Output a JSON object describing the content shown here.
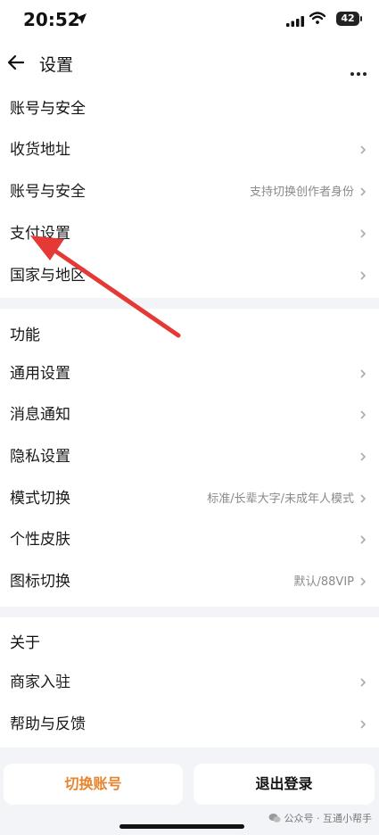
{
  "status_bar": {
    "time": "20:52",
    "battery": "42"
  },
  "header": {
    "title": "设置"
  },
  "sections": [
    {
      "title": "账号与安全",
      "items": [
        {
          "label": "收货地址",
          "hint": ""
        },
        {
          "label": "账号与安全",
          "hint": "支持切换创作者身份"
        },
        {
          "label": "支付设置",
          "hint": ""
        },
        {
          "label": "国家与地区",
          "hint": ""
        }
      ]
    },
    {
      "title": "功能",
      "items": [
        {
          "label": "通用设置",
          "hint": ""
        },
        {
          "label": "消息通知",
          "hint": ""
        },
        {
          "label": "隐私设置",
          "hint": ""
        },
        {
          "label": "模式切换",
          "hint": "标准/长辈大字/未成年人模式"
        },
        {
          "label": "个性皮肤",
          "hint": ""
        },
        {
          "label": "图标切换",
          "hint": "默认/88VIP"
        }
      ]
    },
    {
      "title": "关于",
      "items": [
        {
          "label": "商家入驻",
          "hint": ""
        },
        {
          "label": "帮助与反馈",
          "hint": ""
        }
      ]
    }
  ],
  "buttons": {
    "switch_account": "切换账号",
    "logout": "退出登录"
  },
  "watermark": "公众号 · 互通小帮手",
  "colors": {
    "accent": "#e8842e",
    "annotation_arrow": "#e53935"
  }
}
